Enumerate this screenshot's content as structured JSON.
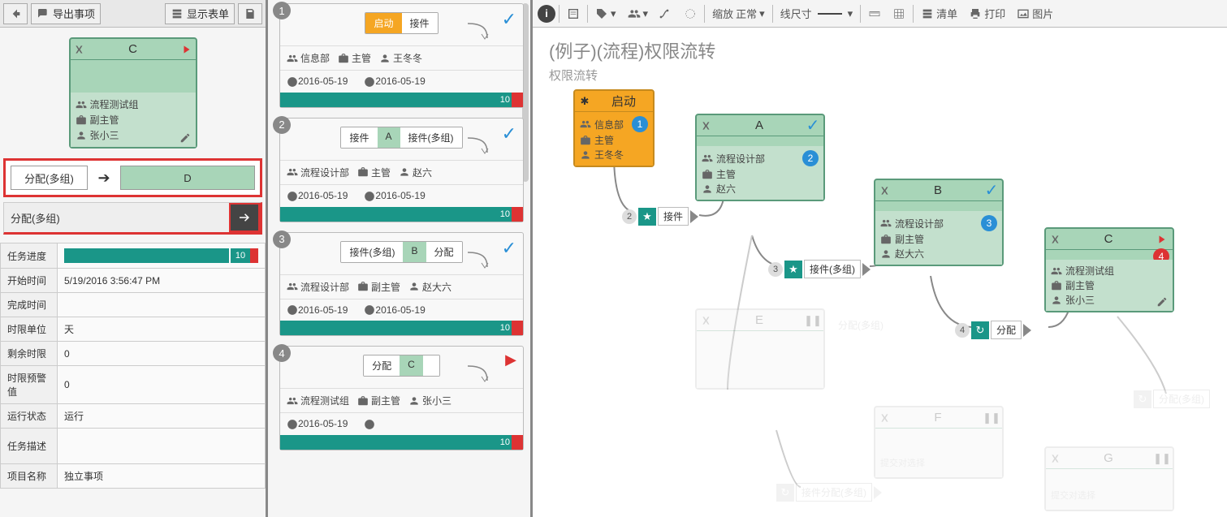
{
  "leftToolbar": {
    "export": "导出事项",
    "showForm": "显示表单"
  },
  "detailNode": {
    "title": "C",
    "group": "流程测试组",
    "role": "副主管",
    "person": "张小三"
  },
  "transition": {
    "label": "分配(多组)",
    "target": "D"
  },
  "transition2": "分配(多组)",
  "task": {
    "progress": {
      "label": "任务进度",
      "value": "10"
    },
    "start": {
      "label": "开始时间",
      "value": "5/19/2016 3:56:47 PM"
    },
    "end": {
      "label": "完成时间",
      "value": ""
    },
    "unit": {
      "label": "时限单位",
      "value": "天"
    },
    "remain": {
      "label": "剩余时限",
      "value": "0"
    },
    "warn": {
      "label": "时限预警值",
      "value": "0"
    },
    "state": {
      "label": "运行状态",
      "value": "运行"
    },
    "desc": {
      "label": "任务描述",
      "value": ""
    },
    "proj": {
      "label": "项目名称",
      "value": "独立事项"
    }
  },
  "steps": [
    {
      "num": "1",
      "chips": [
        {
          "t": "启动",
          "c": "orange"
        },
        {
          "t": "接件",
          "c": ""
        }
      ],
      "mark": "check",
      "dept": "信息部",
      "role": "主管",
      "person": "王冬冬",
      "d1": "2016-05-19",
      "d2": "2016-05-19",
      "bar": "10"
    },
    {
      "num": "2",
      "chips": [
        {
          "t": "接件",
          "c": ""
        },
        {
          "t": "A",
          "c": "green"
        },
        {
          "t": "接件(多组)",
          "c": ""
        }
      ],
      "mark": "check",
      "dept": "流程设计部",
      "role": "主管",
      "person": "赵六",
      "d1": "2016-05-19",
      "d2": "2016-05-19",
      "bar": "10"
    },
    {
      "num": "3",
      "chips": [
        {
          "t": "接件(多组)",
          "c": ""
        },
        {
          "t": "B",
          "c": "green"
        },
        {
          "t": "分配",
          "c": ""
        }
      ],
      "mark": "check",
      "dept": "流程设计部",
      "role": "副主管",
      "person": "赵大六",
      "d1": "2016-05-19",
      "d2": "2016-05-19",
      "bar": "10"
    },
    {
      "num": "4",
      "chips": [
        {
          "t": "分配",
          "c": ""
        },
        {
          "t": "C",
          "c": "green"
        },
        {
          "t": "",
          "c": ""
        }
      ],
      "mark": "play",
      "dept": "流程测试组",
      "role": "副主管",
      "person": "张小三",
      "d1": "2016-05-19",
      "d2": "",
      "bar": "10"
    }
  ],
  "rightToolbar": {
    "zoom": "缩放",
    "normal": "正常",
    "line": "线尺寸",
    "list": "清单",
    "print": "打印",
    "image": "图片"
  },
  "canvasTitle": {
    "t1": "(例子)(流程)权限流转",
    "t2": "权限流转"
  },
  "cnodes": {
    "start": {
      "title": "启动",
      "dept": "信息部",
      "role": "主管",
      "person": "王冬冬",
      "badge": "1"
    },
    "A": {
      "title": "A",
      "dept": "流程设计部",
      "role": "主管",
      "person": "赵六",
      "badge": "2"
    },
    "B": {
      "title": "B",
      "dept": "流程设计部",
      "role": "副主管",
      "person": "赵大六",
      "badge": "3"
    },
    "C": {
      "title": "C",
      "dept": "流程测试组",
      "role": "副主管",
      "person": "张小三",
      "badge": "4"
    },
    "E": {
      "title": "E"
    },
    "F": {
      "title": "F"
    },
    "G": {
      "title": "G"
    }
  },
  "connectors": {
    "c1": {
      "num": "2",
      "label": "接件"
    },
    "c2": {
      "num": "3",
      "label": "接件(多组)"
    },
    "c3": {
      "num": "4",
      "label": "分配"
    },
    "g1": {
      "label": "分配(多组)"
    },
    "g2": {
      "label": "接件分配(多组)"
    },
    "g3": {
      "label": "提交对选择"
    },
    "g4": {
      "label": "提交对选择"
    },
    "g5": {
      "label": "分配(多组)"
    }
  }
}
